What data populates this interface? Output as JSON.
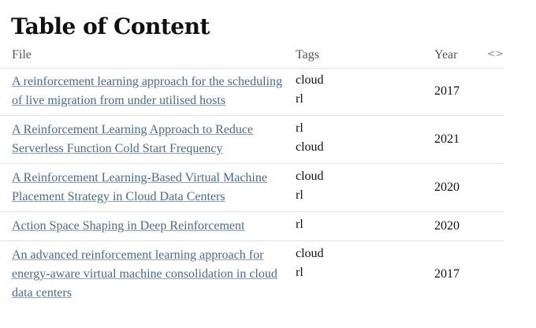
{
  "page": {
    "title": "Table of Content"
  },
  "table": {
    "headers": {
      "file": "File",
      "tags": "Tags",
      "year": "Year",
      "sort_icon": "<>"
    },
    "rows": [
      {
        "file": "A reinforcement learning approach for the scheduling of live migration from under utilised hosts",
        "tags": [
          "cloud",
          "rl"
        ],
        "year": "2017"
      },
      {
        "file": "A Reinforcement Learning Approach to Reduce Serverless Function Cold Start Frequency",
        "tags": [
          "rl",
          "cloud"
        ],
        "year": "2021"
      },
      {
        "file": "A Reinforcement Learning-Based Virtual Machine Placement Strategy in Cloud Data Centers",
        "tags": [
          "cloud",
          "rl"
        ],
        "year": "2020"
      },
      {
        "file": "Action Space Shaping in Deep Reinforcement",
        "tags": [
          "rl"
        ],
        "year": "2020"
      },
      {
        "file": "An advanced reinforcement learning approach for energy-aware virtual machine consolidation in cloud data centers",
        "tags": [
          "cloud",
          "rl"
        ],
        "year": "2017"
      }
    ]
  }
}
